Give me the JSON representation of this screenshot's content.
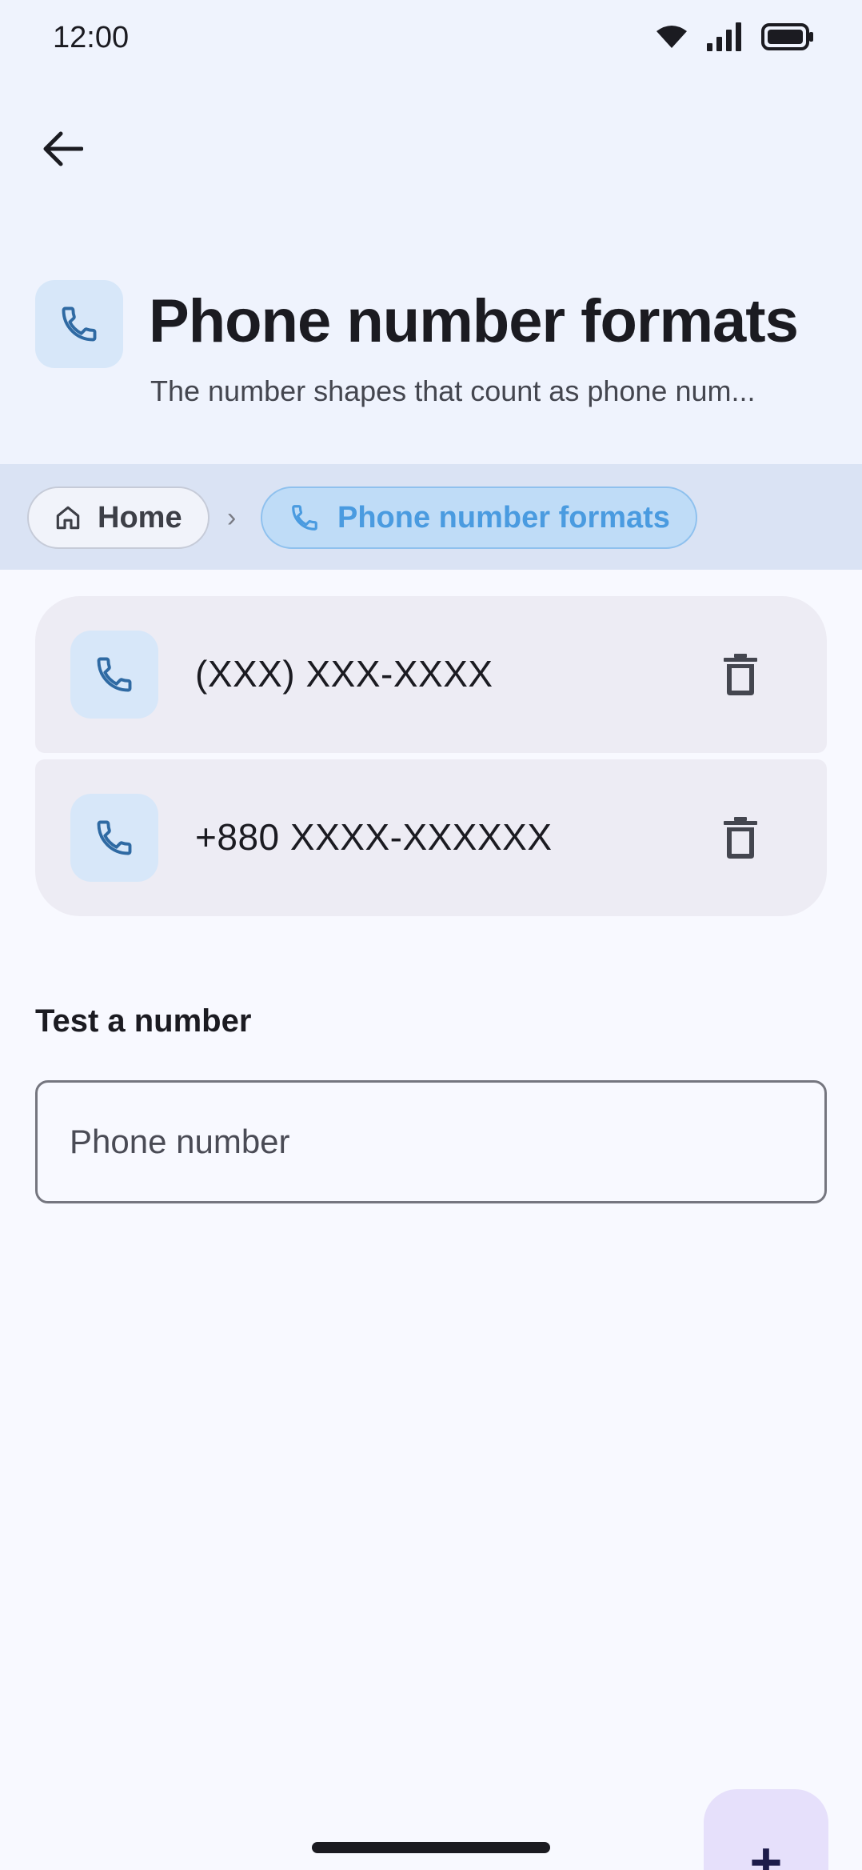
{
  "status_bar": {
    "time": "12:00"
  },
  "header": {
    "title": "Phone number formats",
    "subtitle": "The number shapes that count as phone num..."
  },
  "breadcrumb": {
    "home_label": "Home",
    "current_label": "Phone number formats"
  },
  "formats": [
    {
      "pattern": "(XXX) XXX-XXXX"
    },
    {
      "pattern": "+880 XXXX-XXXXXX"
    }
  ],
  "test": {
    "label": "Test a number",
    "placeholder": "Phone number",
    "value": ""
  },
  "fab": {
    "label": "+"
  },
  "colors": {
    "accent": "#4a9be0",
    "icon_blue": "#2f6aa3",
    "card_bg": "#edecf4",
    "fab_bg": "#e6e0fb"
  },
  "icons": {
    "back": "arrow-left-icon",
    "phone": "phone-icon",
    "home": "home-icon",
    "delete": "trash-icon"
  }
}
